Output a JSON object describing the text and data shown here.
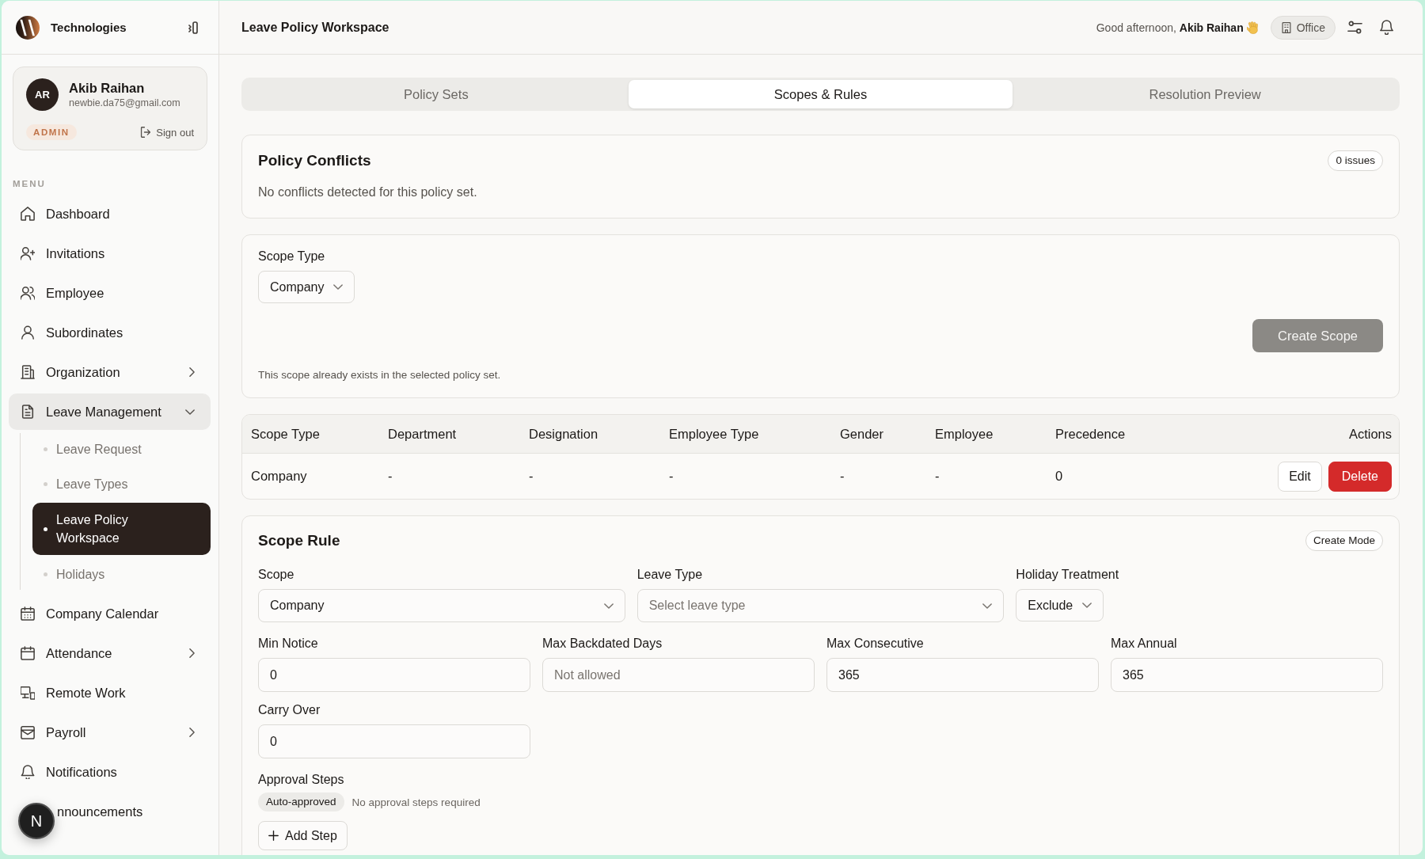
{
  "sidebar": {
    "brand": "Technologies",
    "user_card": {
      "initials": "AR",
      "name": "Akib Raihan",
      "email": "newbie.da75@gmail.com",
      "role": "ADMIN",
      "sign_out": "Sign out"
    },
    "menu_label": "MENU",
    "items": [
      {
        "label": "Dashboard",
        "kind": "link",
        "selected": false
      },
      {
        "label": "Invitations",
        "kind": "link",
        "selected": false
      },
      {
        "label": "Employee",
        "kind": "link",
        "selected": false
      },
      {
        "label": "Subordinates",
        "kind": "link",
        "selected": false
      },
      {
        "label": "Organization",
        "kind": "group",
        "selected": false,
        "expanded": false
      },
      {
        "label": "Leave Management",
        "kind": "group",
        "selected": true,
        "expanded": true,
        "children": [
          {
            "label": "Leave Request",
            "selected": false
          },
          {
            "label": "Leave Types",
            "selected": false
          },
          {
            "label": "Leave Policy Workspace",
            "selected": true
          },
          {
            "label": "Holidays",
            "selected": false
          }
        ]
      },
      {
        "label": "Company Calendar",
        "kind": "link",
        "selected": false
      },
      {
        "label": "Attendance",
        "kind": "group",
        "selected": false,
        "expanded": false
      },
      {
        "label": "Remote Work",
        "kind": "link",
        "selected": false
      },
      {
        "label": "Payroll",
        "kind": "group",
        "selected": false,
        "expanded": false
      },
      {
        "label": "Notifications",
        "kind": "link",
        "selected": false
      },
      {
        "label": "nnouncements",
        "kind": "link",
        "selected": false
      }
    ]
  },
  "dev_indicator": {
    "letter": "N"
  },
  "header": {
    "title": "Leave Policy Workspace",
    "greeting": "Good afternoon, **Akib Raihan**",
    "location": "Office"
  },
  "tabs": [
    {
      "label": "Policy Sets",
      "selected": false
    },
    {
      "label": "Scopes & Rules",
      "selected": true
    },
    {
      "label": "Resolution Preview",
      "selected": false
    }
  ],
  "conflicts": {
    "title": "Policy Conflicts",
    "count": "0 issues",
    "message": "No conflicts detected for this policy set."
  },
  "scope_form": {
    "field": {
      "label": "Scope Type",
      "kind": "dropdown",
      "value": "Company"
    },
    "button": {
      "label": "Create Scope",
      "disabled": true
    },
    "note": "This scope already exists in the selected policy set."
  },
  "scope_table": {
    "columns": [
      "Scope Type",
      "Department",
      "Designation",
      "Employee Type",
      "Gender",
      "Employee",
      "Precedence",
      "Actions"
    ],
    "rows": [
      {
        "cells": [
          "Company",
          "-",
          "-",
          "-",
          "-",
          "-",
          "0"
        ],
        "actions": [
          {
            "label": "Edit",
            "kind": "secondary"
          },
          {
            "label": "Delete",
            "kind": "danger"
          }
        ]
      }
    ]
  },
  "scope_rule": {
    "title": "Scope Rule",
    "mode": "Create Mode",
    "selectors": [
      {
        "label": "Scope",
        "kind": "select",
        "value": "Company"
      },
      {
        "label": "Leave Type",
        "kind": "select",
        "placeholder": "Select leave type"
      },
      {
        "label": "Holiday Treatment",
        "kind": "dropdown",
        "value": "Exclude"
      }
    ],
    "limits": [
      {
        "label": "Min Notice",
        "value": "0"
      },
      {
        "label": "Max Backdated Days",
        "placeholder": "Not allowed"
      },
      {
        "label": "Max Consecutive",
        "value": "365"
      },
      {
        "label": "Max Annual",
        "value": "365"
      },
      {
        "label": "Carry Over",
        "value": "0"
      }
    ],
    "approval_steps": {
      "label": "Approval Steps",
      "status": "Auto-approved",
      "note": "No approval steps required",
      "add_button": "Add Step"
    }
  }
}
